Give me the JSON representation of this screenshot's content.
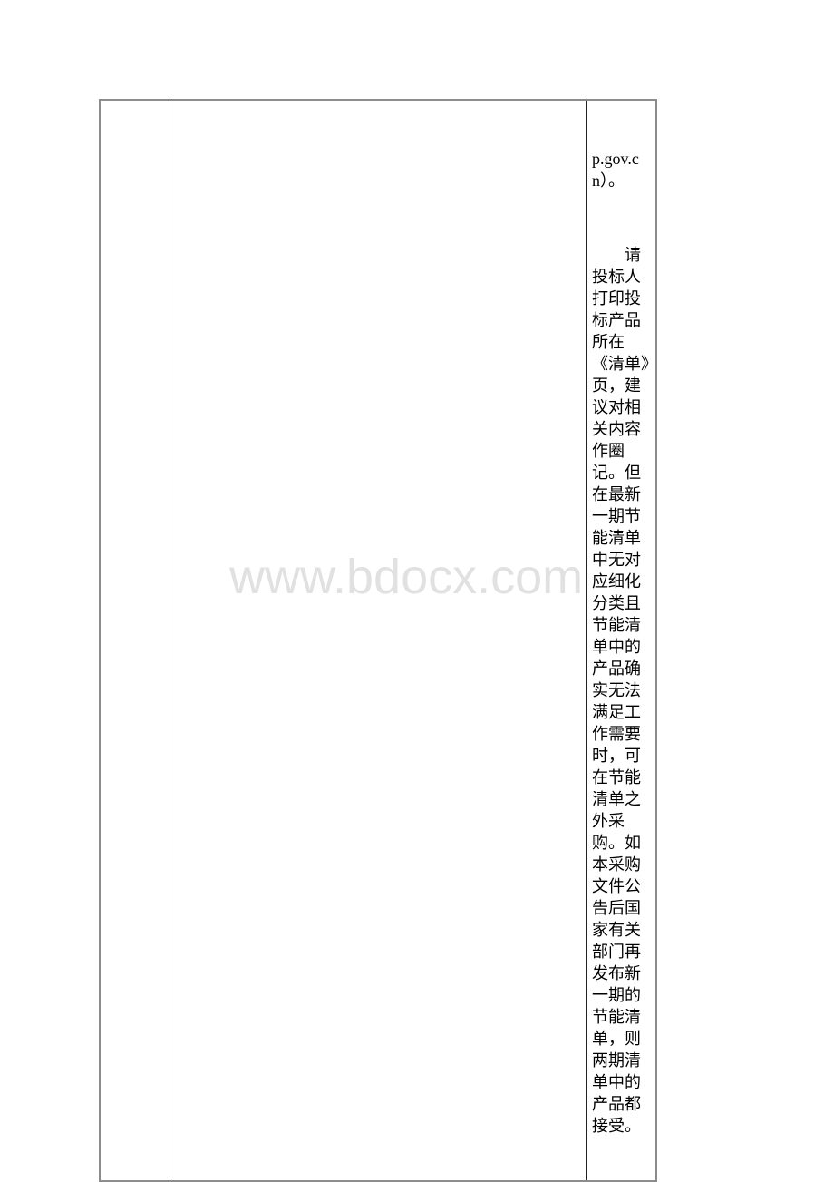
{
  "document": {
    "table": {
      "rows": [
        {
          "cells": [
            {
              "text": ""
            },
            {
              "text": ""
            },
            {
              "paragraphs": [
                "p.gov.cn）。",
                "　　请投标人打印投标产品所在《清单》页，建议对相关内容作圈记。但在最新一期节能清单中无对应细化分类且节能清单中的产品确实无法满足工作需要时，可在节能清单之外采购。如本采购文件公告后国家有关部门再发布新一期的节能清单，则两期清单中的产品都接受。"
              ]
            }
          ]
        }
      ]
    },
    "watermark": "www.bdocx.com"
  }
}
